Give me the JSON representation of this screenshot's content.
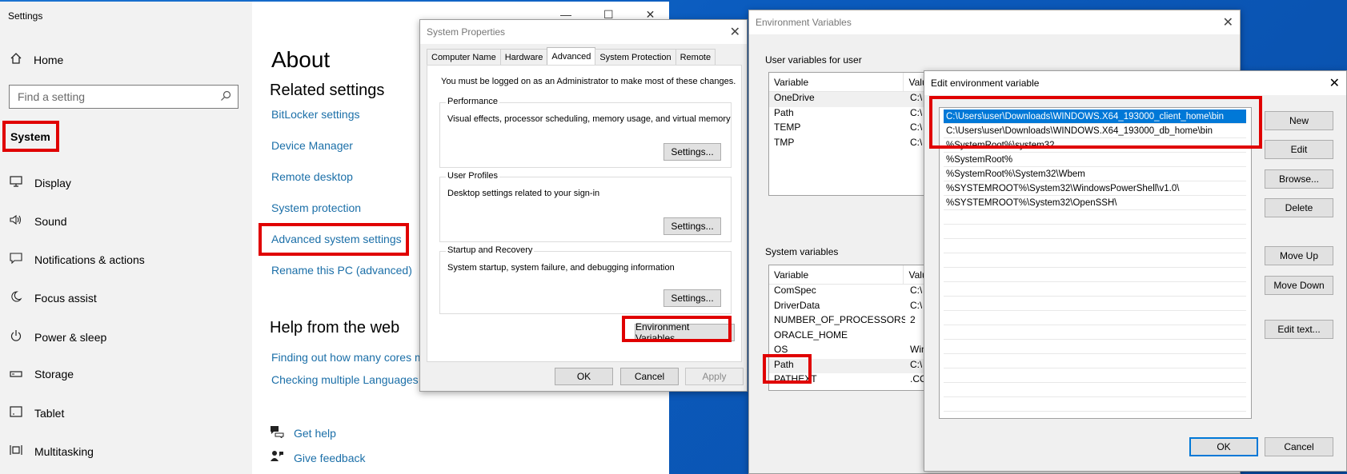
{
  "settings": {
    "title": "Settings",
    "home_label": "Home",
    "search_placeholder": "Find a setting",
    "category_label": "System",
    "nav_items": [
      {
        "icon": "display-icon",
        "label": "Display"
      },
      {
        "icon": "sound-icon",
        "label": "Sound"
      },
      {
        "icon": "notifications-icon",
        "label": "Notifications & actions"
      },
      {
        "icon": "focus-assist-icon",
        "label": "Focus assist"
      },
      {
        "icon": "power-icon",
        "label": "Power & sleep"
      },
      {
        "icon": "storage-icon",
        "label": "Storage"
      },
      {
        "icon": "tablet-icon",
        "label": "Tablet"
      },
      {
        "icon": "multitasking-icon",
        "label": "Multitasking"
      }
    ],
    "page_title": "About",
    "related_heading": "Related settings",
    "related_links": [
      "BitLocker settings",
      "Device Manager",
      "Remote desktop",
      "System protection",
      "Advanced system settings",
      "Rename this PC (advanced)"
    ],
    "help_heading": "Help from the web",
    "help_links": [
      "Finding out how many cores m",
      "Checking multiple Languages"
    ],
    "get_help": "Get help",
    "give_feedback": "Give feedback"
  },
  "system_properties": {
    "title": "System Properties",
    "tabs": [
      "Computer Name",
      "Hardware",
      "Advanced",
      "System Protection",
      "Remote"
    ],
    "active_tab": "Advanced",
    "admin_note": "You must be logged on as an Administrator to make most of these changes.",
    "performance": {
      "label": "Performance",
      "description": "Visual effects, processor scheduling, memory usage, and virtual memory",
      "button": "Settings..."
    },
    "user_profiles": {
      "label": "User Profiles",
      "description": "Desktop settings related to your sign-in",
      "button": "Settings..."
    },
    "startup_recovery": {
      "label": "Startup and Recovery",
      "description": "System startup, system failure, and debugging information",
      "button": "Settings..."
    },
    "env_button": "Environment Variables...",
    "ok": "OK",
    "cancel": "Cancel",
    "apply": "Apply"
  },
  "environment_variables": {
    "title": "Environment Variables",
    "user_section": "User variables for user",
    "system_section": "System variables",
    "col_variable": "Variable",
    "col_value": "Valu",
    "user_rows": [
      {
        "name": "OneDrive",
        "value": "C:\\"
      },
      {
        "name": "Path",
        "value": "C:\\"
      },
      {
        "name": "TEMP",
        "value": "C:\\"
      },
      {
        "name": "TMP",
        "value": "C:\\"
      }
    ],
    "system_rows": [
      {
        "name": "ComSpec",
        "value": "C:\\"
      },
      {
        "name": "DriverData",
        "value": "C:\\"
      },
      {
        "name": "NUMBER_OF_PROCESSORS",
        "value": "2"
      },
      {
        "name": "ORACLE_HOME",
        "value": ""
      },
      {
        "name": "OS",
        "value": "Win"
      },
      {
        "name": "Path",
        "value": "C:\\"
      },
      {
        "name": "PATHEXT",
        "value": ".CO"
      }
    ]
  },
  "edit_env": {
    "title": "Edit environment variable",
    "entries": [
      "C:\\Users\\user\\Downloads\\WINDOWS.X64_193000_client_home\\bin",
      "C:\\Users\\user\\Downloads\\WINDOWS.X64_193000_db_home\\bin",
      "%SystemRoot%\\system32",
      "%SystemRoot%",
      "%SystemRoot%\\System32\\Wbem",
      "%SYSTEMROOT%\\System32\\WindowsPowerShell\\v1.0\\",
      "%SYSTEMROOT%\\System32\\OpenSSH\\"
    ],
    "buttons": {
      "new": "New",
      "edit": "Edit",
      "browse": "Browse...",
      "delete": "Delete",
      "move_up": "Move Up",
      "move_down": "Move Down",
      "edit_text": "Edit text...",
      "ok": "OK",
      "cancel": "Cancel"
    }
  },
  "colors": {
    "highlight_box": "#e00000",
    "link": "#1b6fa8",
    "selection": "#0078d7",
    "desktop": "#0b5cbf"
  }
}
